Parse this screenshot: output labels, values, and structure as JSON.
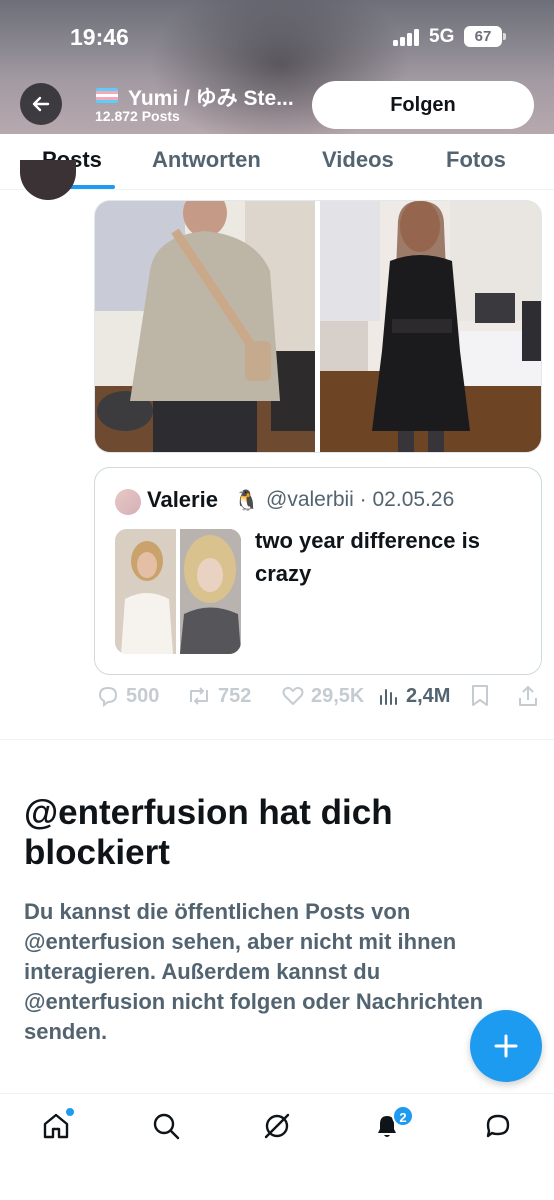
{
  "status_bar": {
    "time": "19:46",
    "network": "5G",
    "battery": "67"
  },
  "header": {
    "name": "Yumi / ゆみ Ste...",
    "post_count": "12.872 Posts",
    "follow_label": "Folgen"
  },
  "tabs": [
    {
      "label": "Posts",
      "active": true
    },
    {
      "label": "Antworten",
      "active": false
    },
    {
      "label": "Videos",
      "active": false
    },
    {
      "label": "Fotos",
      "active": false
    }
  ],
  "tweet": {
    "quote": {
      "name": "Valerie",
      "emoji": "🐧",
      "handle_date": "@valerbii · 02.05.26",
      "text": "two year difference is crazy"
    },
    "actions": {
      "replies": "500",
      "reposts": "752",
      "likes": "29,5K",
      "views": "2,4M"
    }
  },
  "block_notice": {
    "title": "@enterfusion hat dich blockiert",
    "body": "Du kannst die öffentlichen Posts von @enterfusion sehen, aber nicht mit ihnen interagieren. Außerdem kannst du @enterfusion nicht folgen oder Nachrichten senden."
  },
  "bottom_nav": {
    "items": [
      "home-icon",
      "search-icon",
      "grok-icon",
      "notifications-icon",
      "messages-icon"
    ],
    "notification_count": "2"
  },
  "colors": {
    "accent": "#1d9bf0",
    "text": "#0f1419",
    "secondary": "#536471"
  }
}
